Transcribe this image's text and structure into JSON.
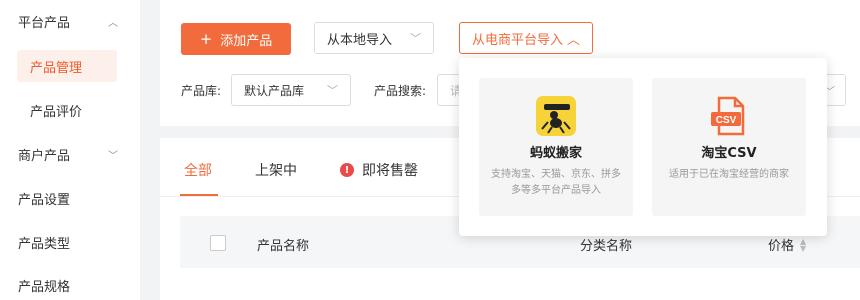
{
  "sidebar": {
    "items": [
      {
        "label": "平台产品",
        "chevron": "^"
      },
      {
        "label": "产品管理"
      },
      {
        "label": "产品评价"
      },
      {
        "label": "商户产品",
        "chevron": "v"
      },
      {
        "label": "产品设置"
      },
      {
        "label": "产品类型"
      },
      {
        "label": "产品规格"
      }
    ]
  },
  "toolbar": {
    "add_label": "添加产品",
    "local_import_label": "从本地导入",
    "ecom_import_label": "从电商平台导入"
  },
  "filters": {
    "library_label": "产品库:",
    "library_value": "默认产品库",
    "search_label": "产品搜索:",
    "search_placeholder": "请"
  },
  "tabs": [
    {
      "label": "全部"
    },
    {
      "label": "上架中"
    },
    {
      "label": "即将售罄"
    }
  ],
  "table": {
    "columns": [
      "产品名称",
      "分类名称",
      "价格"
    ]
  },
  "dropdown": {
    "options": [
      {
        "title": "蚂蚁搬家",
        "desc": "支持淘宝、天猫、京东、拼多多等多平台产品导入",
        "icon": "ant-mover-icon"
      },
      {
        "title": "淘宝CSV",
        "desc": "适用于已在淘宝经营的商家",
        "icon": "csv-file-icon"
      }
    ]
  },
  "colors": {
    "accent": "#f26b3c",
    "warning": "#e84a4a"
  }
}
